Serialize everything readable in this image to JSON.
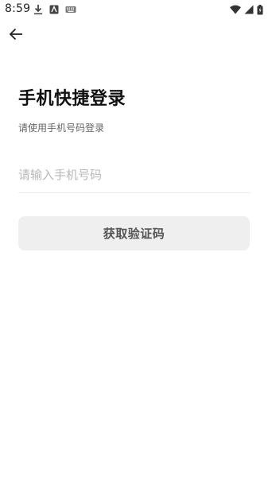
{
  "status_bar": {
    "time": "8:59",
    "left_icons": [
      "download-icon",
      "app-notification-icon",
      "keyboard-icon"
    ],
    "right_icons": [
      "wifi-icon",
      "signal-icon",
      "battery-icon"
    ]
  },
  "header": {
    "back_icon": "arrow-left-icon"
  },
  "login": {
    "title": "手机快捷登录",
    "subtitle": "请使用手机号码登录",
    "phone_placeholder": "请输入手机号码",
    "phone_value": "",
    "verify_button_label": "获取验证码"
  },
  "colors": {
    "button_background": "#efefef",
    "button_text": "#555555",
    "placeholder": "#b8b8b8",
    "divider": "#ececec"
  }
}
